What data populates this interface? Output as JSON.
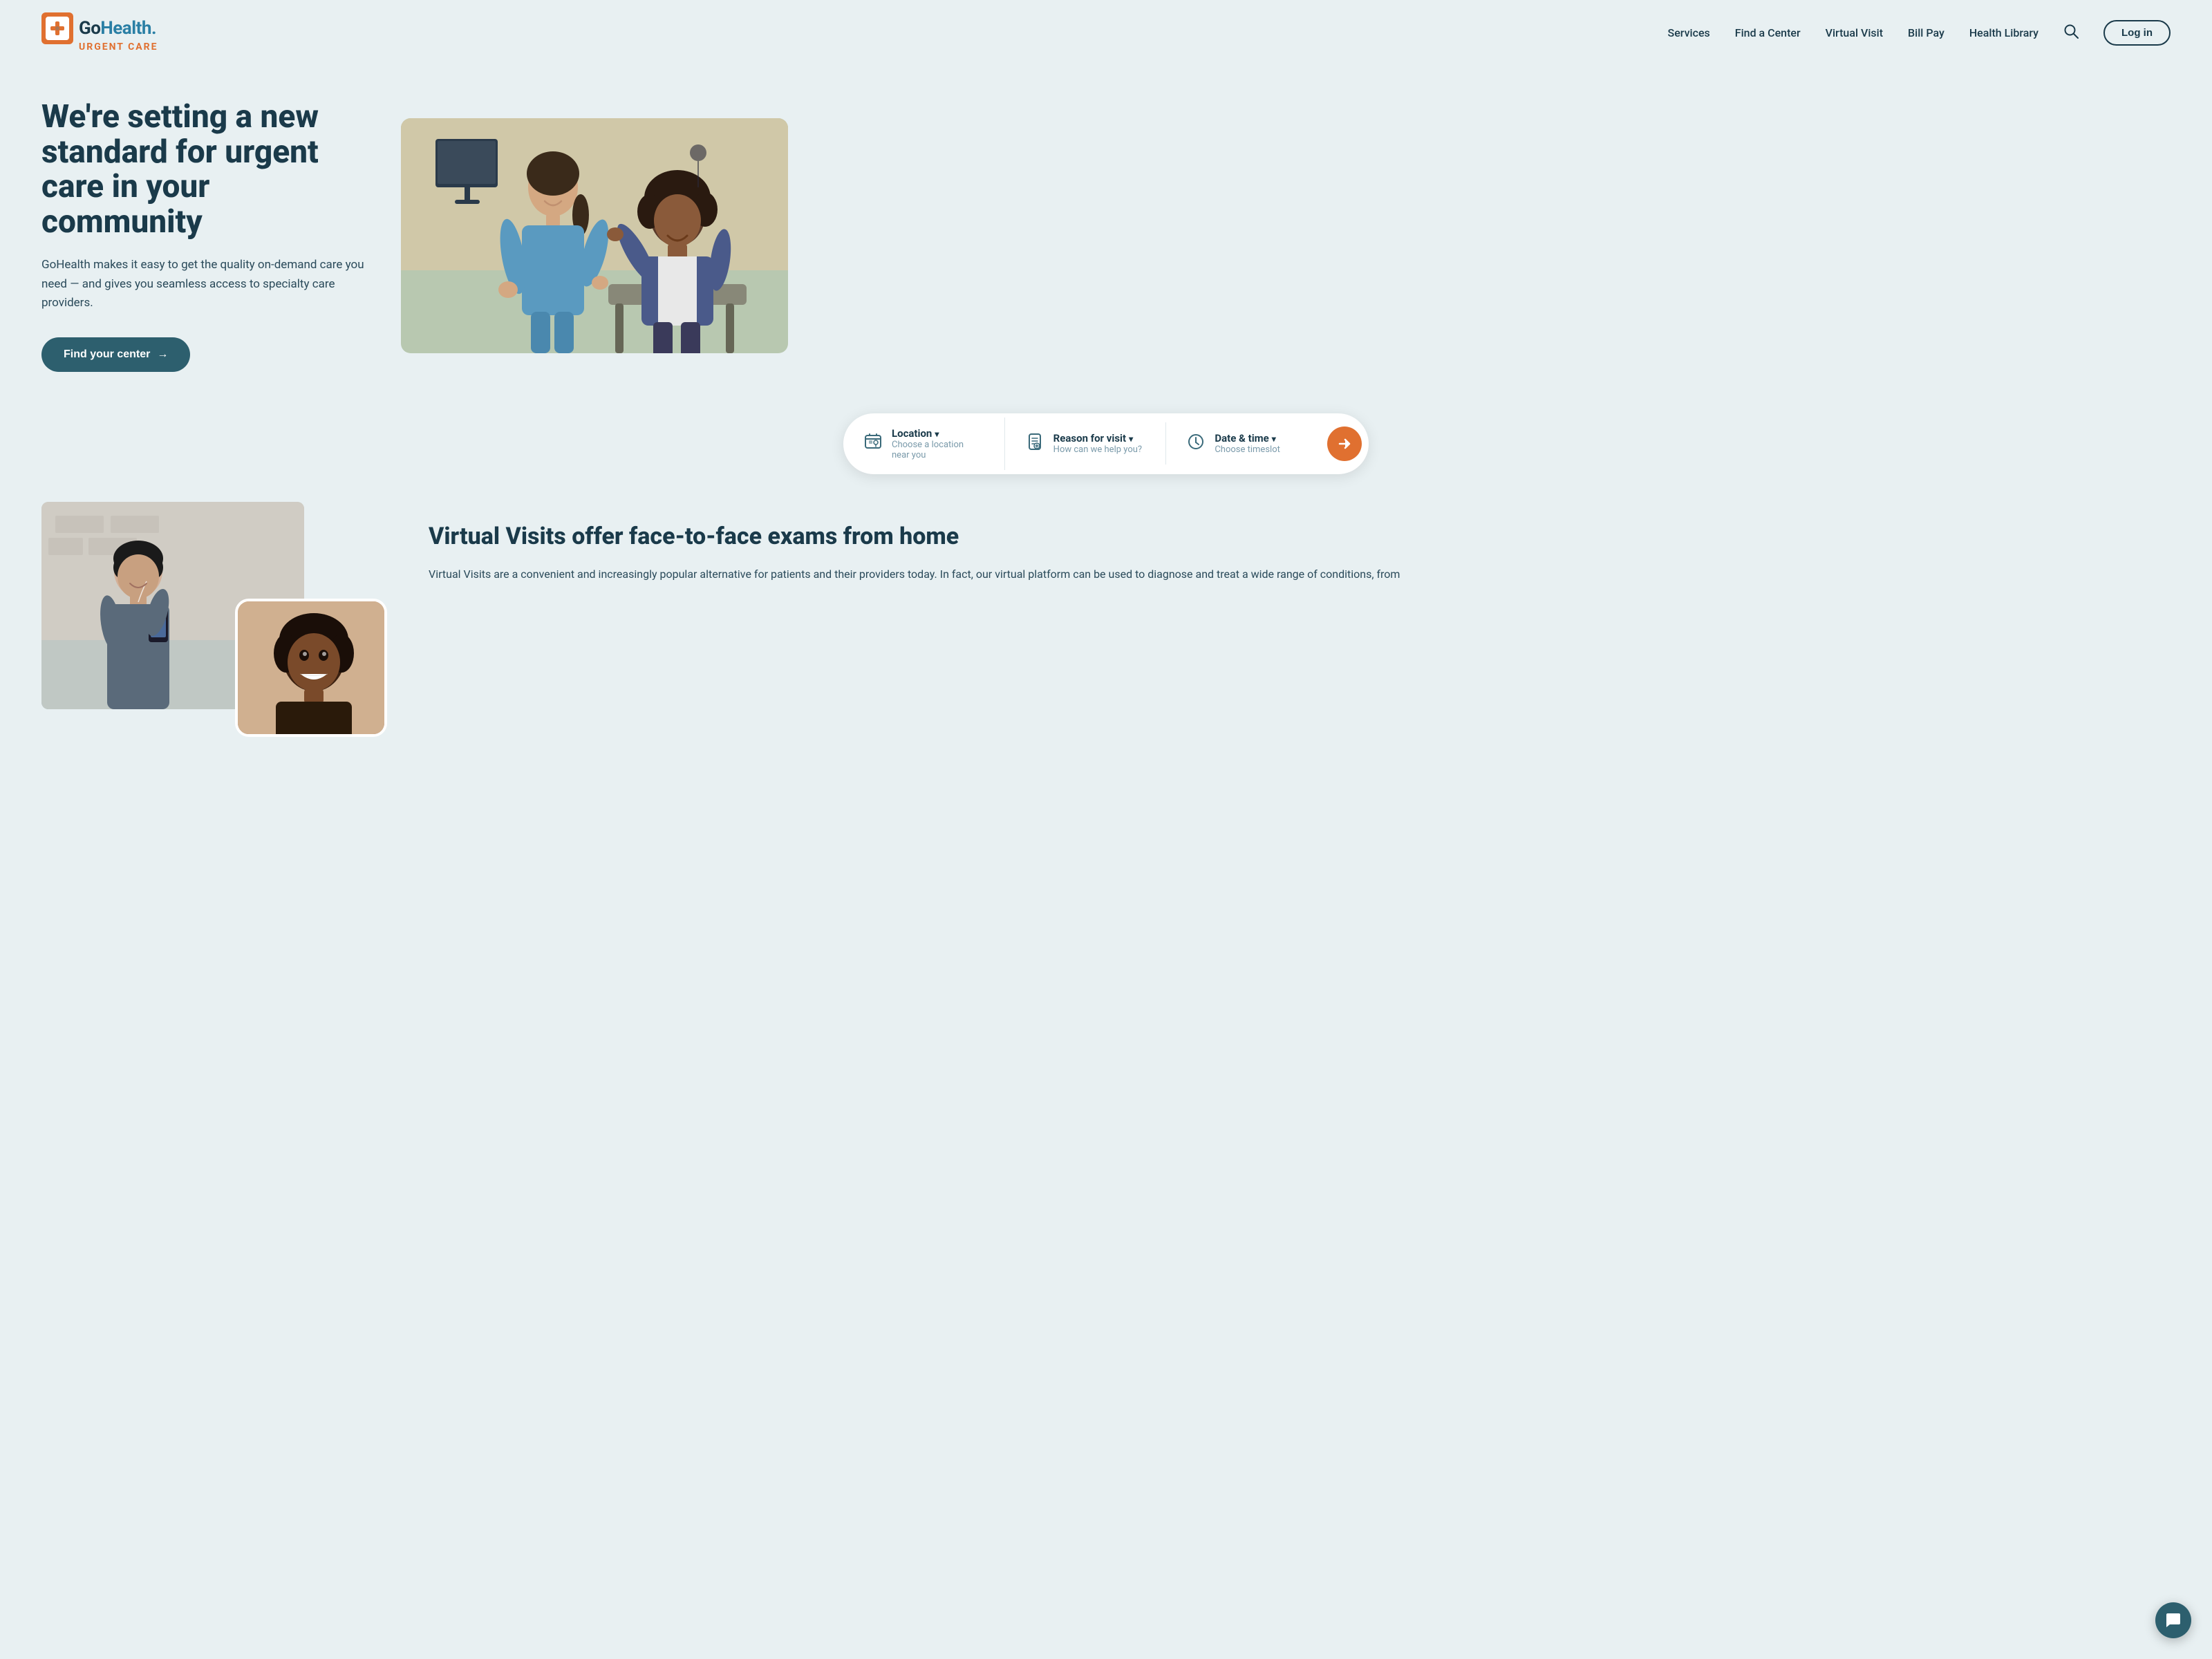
{
  "logo": {
    "go": "Go",
    "health": "Health.",
    "urgent_care": "URGENT CARE"
  },
  "nav": {
    "links": [
      {
        "label": "Services",
        "id": "services"
      },
      {
        "label": "Find a Center",
        "id": "find-center"
      },
      {
        "label": "Virtual Visit",
        "id": "virtual-visit"
      },
      {
        "label": "Bill Pay",
        "id": "bill-pay"
      },
      {
        "label": "Health Library",
        "id": "health-library"
      }
    ],
    "login_label": "Log in"
  },
  "hero": {
    "title": "We're setting a new standard for urgent care in your community",
    "subtitle": "GoHealth makes it easy to get the quality on-demand care you need — and gives you seamless access to specialty care providers.",
    "cta_label": "Find your center",
    "cta_arrow": "→"
  },
  "booking": {
    "location": {
      "label": "Location",
      "sublabel": "Choose a location near you",
      "chevron": "▾"
    },
    "reason": {
      "label": "Reason for visit",
      "sublabel": "How can we help you?",
      "chevron": "▾"
    },
    "datetime": {
      "label": "Date & time",
      "sublabel": "Choose timeslot",
      "chevron": "▾"
    },
    "submit_arrow": "→"
  },
  "virtual": {
    "title": "Virtual Visits offer face-to-face exams from home",
    "description": "Virtual Visits are a convenient and increasingly popular alternative for patients and their providers today. In fact, our virtual platform can be used to diagnose and treat a wide range of conditions, from"
  },
  "chat": {
    "icon": "💬"
  }
}
